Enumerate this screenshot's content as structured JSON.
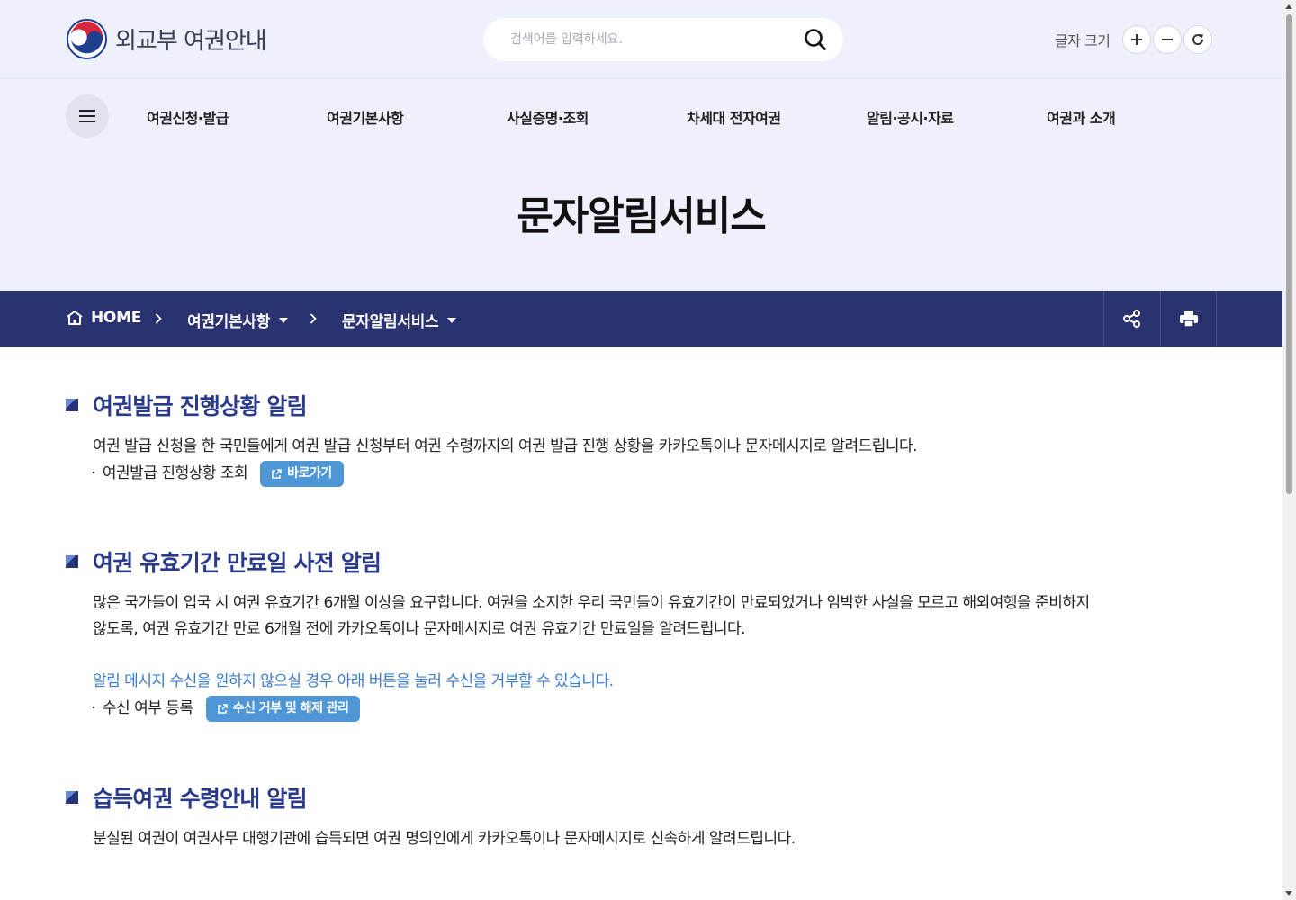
{
  "header": {
    "logo_text": "외교부 여권안내",
    "search_placeholder": "검색어를 입력하세요.",
    "font_size_label": "글자 크기"
  },
  "gnb": {
    "items": [
      {
        "label": "여권신청·발급"
      },
      {
        "label": "여권기본사항"
      },
      {
        "label": "사실증명·조회"
      },
      {
        "label": "차세대 전자여권"
      },
      {
        "label": "알림·공시·자료"
      },
      {
        "label": "여권과 소개"
      }
    ]
  },
  "page": {
    "title": "문자알림서비스"
  },
  "breadcrumb": {
    "home": "HOME",
    "level1": "여권기본사항",
    "level2": "문자알림서비스"
  },
  "sections": [
    {
      "title": "여권발급 진행상황 알림",
      "desc": "여권 발급 신청을 한 국민들에게 여권 발급 신청부터 여권 수령까지의 여권 발급 진행 상황을 카카오톡이나 문자메시지로 알려드립니다.",
      "bullet": "여권발급 진행상황 조회",
      "button": "바로가기"
    },
    {
      "title": "여권 유효기간 만료일 사전 알림",
      "desc1": "많은 국가들이 입국 시 여권 유효기간 6개월 이상을 요구합니다. 여권을 소지한 우리 국민들이 유효기간이 만료되었거나 임박한 사실을 모르고 해외여행을 준비하지",
      "desc2": "않도록, 여권 유효기간 만료 6개월 전에 카카오톡이나 문자메시지로 여권 유효기간 만료일을 알려드립니다.",
      "notice": "알림 메시지 수신을 원하지 않으실 경우 아래 버튼을 눌러 수신을 거부할 수 있습니다.",
      "bullet": "수신 여부 등록",
      "button": "수신 거부 및 해제 관리"
    },
    {
      "title": "습득여권 수령안내 알림",
      "desc": "분실된 여권이 여권사무 대행기관에 습득되면 여권 명의인에게 카카오톡이나 문자메시지로 신속하게 알려드립니다."
    }
  ],
  "colors": {
    "header_bg": "#eef0fb",
    "breadcrumb_bg": "#2b3270",
    "section_title": "#2a3a8a",
    "button_bg": "#4e96d6",
    "notice_text": "#3b7bd0"
  }
}
